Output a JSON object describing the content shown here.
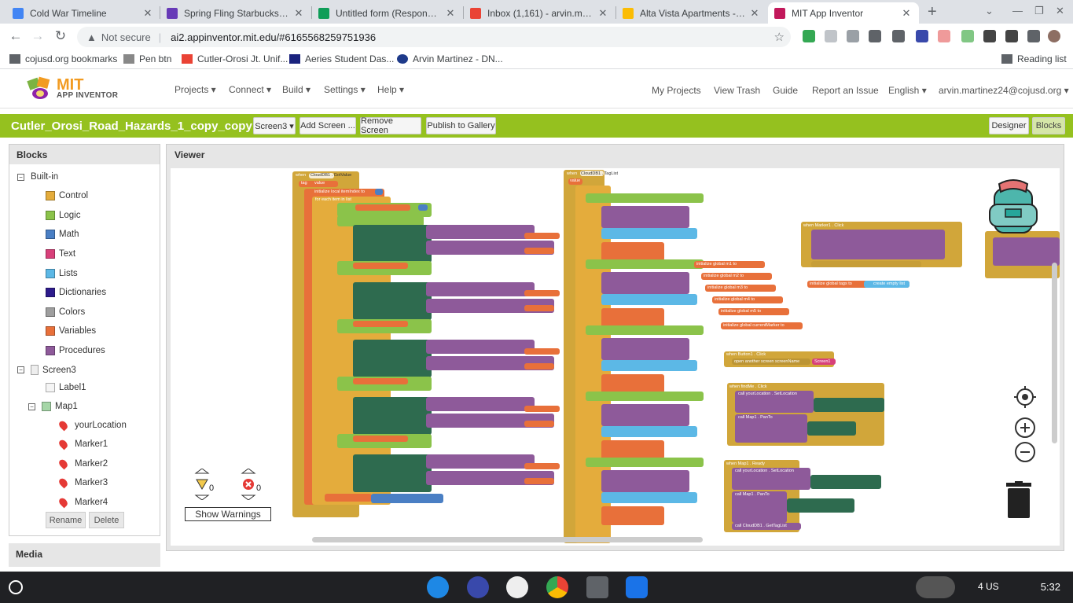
{
  "browser": {
    "tabs": [
      {
        "title": "Cold War Timeline",
        "color": "#4285f4"
      },
      {
        "title": "Spring Fling Starbucks - Goo",
        "color": "#673ab7"
      },
      {
        "title": "Untitled form (Responses) - ",
        "color": "#0f9d58"
      },
      {
        "title": "Inbox (1,161) - arvin.martine",
        "color": "#ea4335"
      },
      {
        "title": "Alta Vista Apartments - Goo",
        "color": "#fbbc04"
      },
      {
        "title": "MIT App Inventor",
        "color": "#c2185b"
      }
    ],
    "new_tab_label": "+",
    "address": {
      "security": "Not secure",
      "url": "ai2.appinventor.mit.edu/#6165568259751936"
    },
    "bookmarks": [
      {
        "label": "cojusd.org bookmarks"
      },
      {
        "label": "Pen btn"
      },
      {
        "label": "Cutler-Orosi Jt. Unif..."
      },
      {
        "label": "Aeries Student Das..."
      },
      {
        "label": "Arvin Martinez - DN..."
      }
    ],
    "reading_list": "Reading list"
  },
  "ai_header": {
    "logo_mit": "MIT",
    "logo_app": "APP INVENTOR",
    "menus": [
      "Projects ▾",
      "Connect ▾",
      "Build ▾",
      "Settings ▾",
      "Help ▾"
    ],
    "right_links": [
      "My Projects",
      "View Trash",
      "Guide",
      "Report an Issue",
      "English ▾",
      "arvin.martinez24@cojusd.org ▾"
    ]
  },
  "project_bar": {
    "title": "Cutler_Orosi_Road_Hazards_1_copy_copy",
    "screen_select": "Screen3 ▾",
    "add_screen": "Add Screen ...",
    "remove_screen": "Remove Screen",
    "publish": "Publish to Gallery",
    "designer": "Designer",
    "blocks": "Blocks"
  },
  "blocks_panel": {
    "header": "Blocks",
    "builtin_label": "Built-in",
    "builtin": [
      {
        "label": "Control",
        "color": "#e4ac3c"
      },
      {
        "label": "Logic",
        "color": "#8bc34a"
      },
      {
        "label": "Math",
        "color": "#4a7fc4"
      },
      {
        "label": "Text",
        "color": "#d8407a"
      },
      {
        "label": "Lists",
        "color": "#5cb8e6"
      },
      {
        "label": "Dictionaries",
        "color": "#2d1b8c"
      },
      {
        "label": "Colors",
        "color": "#9e9e9e"
      },
      {
        "label": "Variables",
        "color": "#e8703a"
      },
      {
        "label": "Procedures",
        "color": "#8e5a9a"
      }
    ],
    "screen_label": "Screen3",
    "label1": "Label1",
    "map_label": "Map1",
    "markers": [
      "yourLocation",
      "Marker1",
      "Marker2",
      "Marker3",
      "Marker4"
    ],
    "rename": "Rename",
    "delete": "Delete"
  },
  "media_panel": {
    "header": "Media"
  },
  "viewer": {
    "header": "Viewer",
    "warnings_count": "0",
    "errors_count": "0",
    "show_warnings": "Show Warnings",
    "block_texts": {
      "when1": "when",
      "gotvalue": "CloudDB1 . GotValue",
      "tag": "tag",
      "value": "value",
      "init_local": "initialize local itemIndex to",
      "for_each": "for each item in list",
      "when2": "when",
      "taglist": "CloudDB1 . TagList",
      "value2": "value",
      "init_m1": "initialize global m1 to",
      "init_m2": "initialize global m2 to",
      "init_m3": "initialize global m3 to",
      "init_m4": "initialize global m4 to",
      "init_m5": "initialize global m5 to",
      "init_cur": "initialize global currentMarker to",
      "marker1_click": "when Marker1 . Click",
      "init_tags": "initialize global tags to",
      "create_list": "create empty list",
      "button1_click": "when Button1 . Click",
      "open_screen": "open another screen screenName",
      "screen1": "Screen1",
      "findme_click": "when findMe . Click",
      "map_ready": "when Map1 . Ready",
      "set_location": "call yourLocation . SetLocation",
      "panto": "call Map1 . PanTo",
      "gettaglist": "call CloudDB1 . GetTagList"
    }
  },
  "taskbar": {
    "clock": "5:32",
    "tray": "4 US"
  }
}
